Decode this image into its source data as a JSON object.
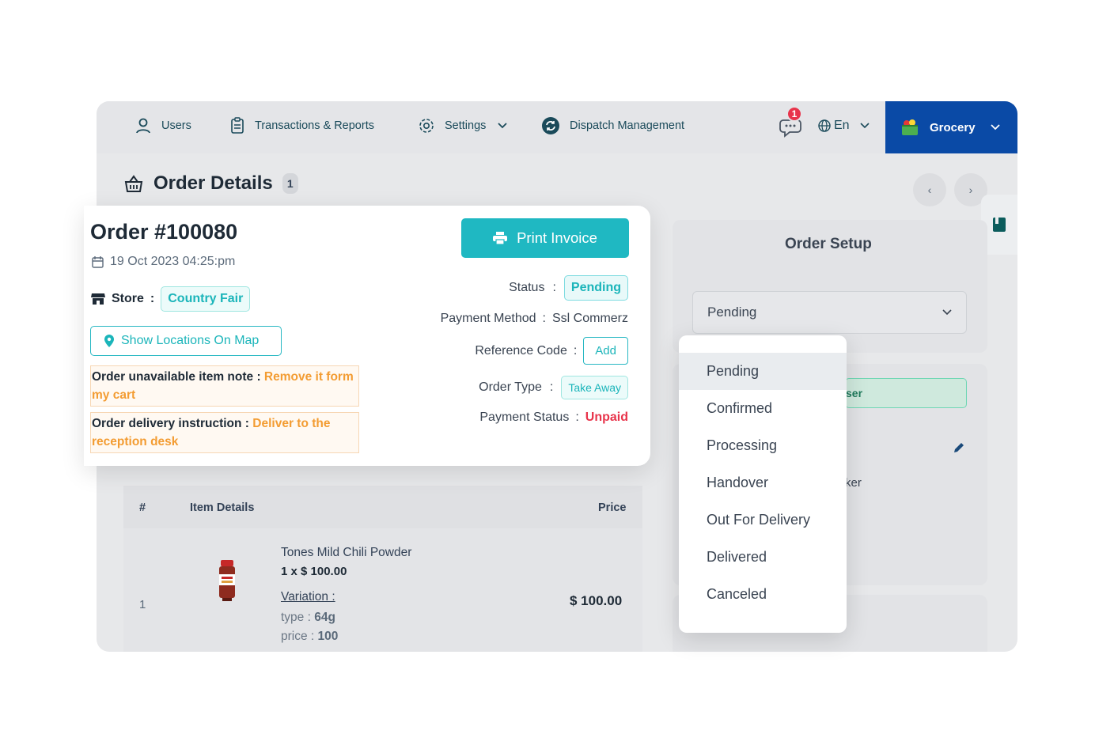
{
  "nav": {
    "users": "Users",
    "transactions": "Transactions & Reports",
    "settings": "Settings",
    "dispatch": "Dispatch Management",
    "chat_badge": "1",
    "language": "En",
    "module": "Grocery"
  },
  "page": {
    "title": "Order Details",
    "count": "1"
  },
  "order": {
    "number": "Order #100080",
    "date": "19 Oct 2023 04:25:pm",
    "store_label": "Store",
    "store_name": "Country Fair",
    "map_button": "Show Locations On Map",
    "unavailable_label": "Order unavailable item note :",
    "unavailable_value": "Remove it form my cart",
    "delivery_label": "Order delivery instruction :",
    "delivery_value": "Deliver to the reception desk",
    "print_button": "Print Invoice",
    "status_label": "Status",
    "status_value": "Pending",
    "payment_method_label": "Payment Method",
    "payment_method_value": "Ssl Commerz",
    "reference_label": "Reference Code",
    "reference_button": "Add",
    "order_type_label": "Order Type",
    "order_type_value": "Take Away",
    "payment_status_label": "Payment Status",
    "payment_status_value": "Unpaid",
    "colon": ":"
  },
  "table": {
    "col_index": "#",
    "col_item": "Item Details",
    "col_price": "Price",
    "row": {
      "index": "1",
      "name": "Tones Mild Chili Powder",
      "qty": "1 x $ 100.00",
      "variation": "Variation :",
      "type_label": "type :",
      "type_value": "64g",
      "price_label": "price :",
      "price_value": "100",
      "total": "$ 100.00"
    }
  },
  "setup": {
    "title": "Order Setup",
    "selected": "Pending",
    "partial_button": "ser",
    "partial_text": "ker"
  },
  "dropdown": {
    "options": [
      "Pending",
      "Confirmed",
      "Processing",
      "Handover",
      "Out For Delivery",
      "Delivered",
      "Canceled"
    ]
  },
  "colors": {
    "accent": "#1fb8c2",
    "module_bg": "#0a4aa6",
    "danger": "#e8344b",
    "warning": "#f39c32"
  }
}
